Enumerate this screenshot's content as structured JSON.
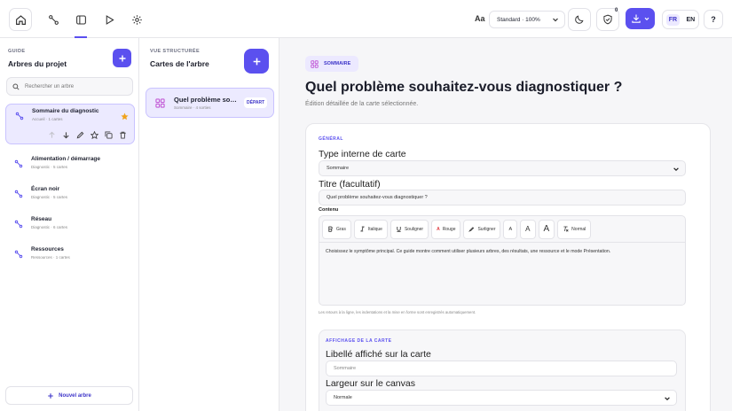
{
  "topbar": {
    "text_size_label": "Aa",
    "zoom_value": "Standard · 100%",
    "shield_count": "0",
    "lang_fr": "FR",
    "lang_en": "EN",
    "help_label": "?",
    "accent": "#5b50ef"
  },
  "left_panel": {
    "kicker": "GUIDE",
    "title": "Arbres du projet",
    "search_placeholder": "Rechercher un arbre",
    "items": [
      {
        "name": "Sommaire du diagnostic",
        "meta": "Accueil · 1 cartes"
      },
      {
        "name": "Alimentation / démarrage",
        "meta": "Diagnostic · 5 cartes"
      },
      {
        "name": "Écran noir",
        "meta": "Diagnostic · 5 cartes"
      },
      {
        "name": "Réseau",
        "meta": "Diagnostic · 6 cartes"
      },
      {
        "name": "Ressources",
        "meta": "Ressources · 1 cartes"
      }
    ],
    "new_tree_label": "Nouvel arbre"
  },
  "mid_panel": {
    "kicker": "VUE STRUCTURÉE",
    "title": "Cartes de l'arbre",
    "card": {
      "name": "Quel problème souhaitez-vous diagnostiquer ?",
      "meta": "Sommaire · 4 sorties",
      "tag": "DÉPART"
    }
  },
  "main": {
    "pill_label": "SOMMAIRE",
    "heading": "Quel problème souhaitez-vous diagnostiquer ?",
    "description": "Édition détaillée de la carte sélectionnée.",
    "section_general": "GÉNÉRAL",
    "type_label": "Type interne de carte",
    "type_value": "Sommaire",
    "title_label": "Titre (facultatif)",
    "title_value": "Quel problème souhaitez-vous diagnostiquer ?",
    "content_label": "Contenu",
    "toolbar": [
      "Gras",
      "Italique",
      "Souligner",
      "Rouge",
      "Surligner",
      "A",
      "A",
      "A",
      "Normal"
    ],
    "content_text": "Choisissez le symptôme principal. Ce guide montre comment utiliser plusieurs arbres, des résultats, une ressource et le mode Présentation.",
    "hint": "Les retours à la ligne, les indentations et la mise en forme sont enregistrés automatiquement.",
    "section_display": "AFFICHAGE DE LA CARTE",
    "card_label_label": "Libellé affiché sur la carte",
    "card_label_placeholder": "Sommaire",
    "width_label": "Largeur sur le canvas",
    "width_value": "Normale"
  }
}
